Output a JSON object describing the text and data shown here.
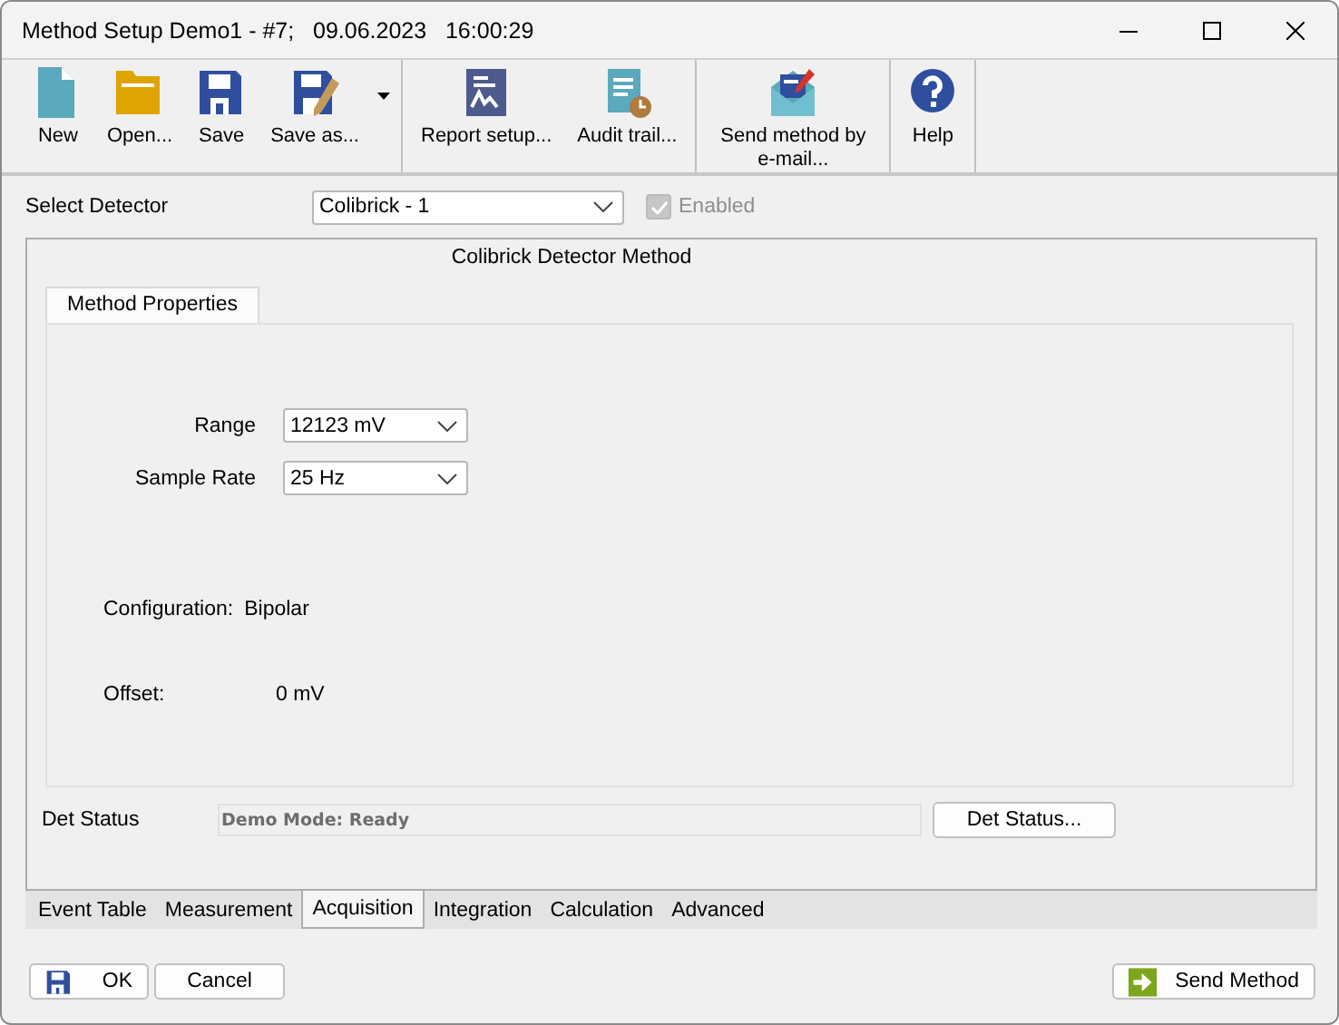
{
  "window": {
    "title": "Method Setup Demo1 - #7;   09.06.2023   16:00:29"
  },
  "toolbar": {
    "groups": [
      {
        "items": [
          {
            "label": "New",
            "kind": "new"
          },
          {
            "label": "Open...",
            "kind": "open"
          },
          {
            "label": "Save",
            "kind": "save"
          },
          {
            "label": "Save as...",
            "kind": "saveas",
            "dropdown": true
          }
        ]
      },
      {
        "items": [
          {
            "label": "Report setup...",
            "kind": "report"
          },
          {
            "label": "Audit trail...",
            "kind": "audit"
          }
        ]
      },
      {
        "items": [
          {
            "label": "Send method by e-mail...",
            "kind": "email"
          }
        ]
      },
      {
        "items": [
          {
            "label": "Help",
            "kind": "help"
          }
        ]
      }
    ]
  },
  "detector": {
    "label": "Select Detector",
    "value": "Colibrick - 1",
    "enabled": {
      "label": "Enabled",
      "checked": true,
      "disabled": true
    }
  },
  "panel": {
    "title": "Colibrick Detector Method",
    "tabs": [
      {
        "label": "Method Properties",
        "selected": true
      }
    ],
    "fields": [
      {
        "label": "Range",
        "value": "12123 mV"
      },
      {
        "label": "Sample Rate",
        "value": "25 Hz"
      }
    ],
    "configuration": {
      "label": "Configuration:",
      "value": "Bipolar"
    },
    "offset": {
      "label": "Offset:",
      "value": "0 mV"
    },
    "det_status": {
      "label": "Det Status",
      "value": "Demo Mode: Ready",
      "button": "Det Status..."
    }
  },
  "bottom_tabs": [
    {
      "label": "Event Table",
      "selected": false
    },
    {
      "label": "Measurement",
      "selected": false
    },
    {
      "label": "Acquisition",
      "selected": true
    },
    {
      "label": "Integration",
      "selected": false
    },
    {
      "label": "Calculation",
      "selected": false
    },
    {
      "label": "Advanced",
      "selected": false
    }
  ],
  "buttons": [
    {
      "label": "OK",
      "kind": "ok"
    },
    {
      "label": "Cancel",
      "kind": "cancel"
    },
    {
      "label": "Send Method",
      "kind": "send"
    }
  ]
}
